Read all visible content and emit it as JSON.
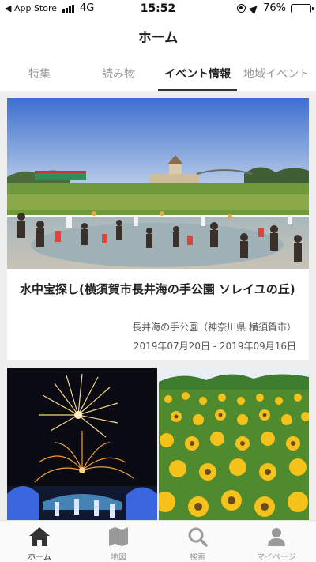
{
  "status_bar": {
    "back_app": "◀ App Store",
    "network": "4G",
    "time": "15:52",
    "battery_percent": "76%",
    "battery_level": 0.76,
    "signal_bars": 4
  },
  "header": {
    "title": "ホーム"
  },
  "tabs": [
    {
      "label": "特集",
      "active": false
    },
    {
      "label": "読み物",
      "active": false
    },
    {
      "label": "イベント情報",
      "active": true
    },
    {
      "label": "地域イベント",
      "active": false
    }
  ],
  "featured_event": {
    "title": "水中宝探し(横須賀市長井海の手公園 ソレイユの丘)",
    "location": "長井海の手公園（神奈川県 横須賀市）",
    "dates": "2019年07月20日 - 2019年09月16日",
    "photo_icon": "water-park-photo"
  },
  "grid_tiles": [
    {
      "icon": "fireworks-photo"
    },
    {
      "icon": "sunflower-field-photo"
    }
  ],
  "bottom_nav": [
    {
      "label": "ホーム",
      "icon": "home-icon",
      "active": true
    },
    {
      "label": "地図",
      "icon": "map-icon",
      "active": false
    },
    {
      "label": "検索",
      "icon": "search-icon",
      "active": false
    },
    {
      "label": "マイページ",
      "icon": "person-icon",
      "active": false
    }
  ],
  "colors": {
    "active_tab_underline": "#333333",
    "inactive_text": "#9a9a9a",
    "content_background": "#eeeeee",
    "nav_active": "#333333",
    "nav_inactive": "#9a9a9a"
  }
}
